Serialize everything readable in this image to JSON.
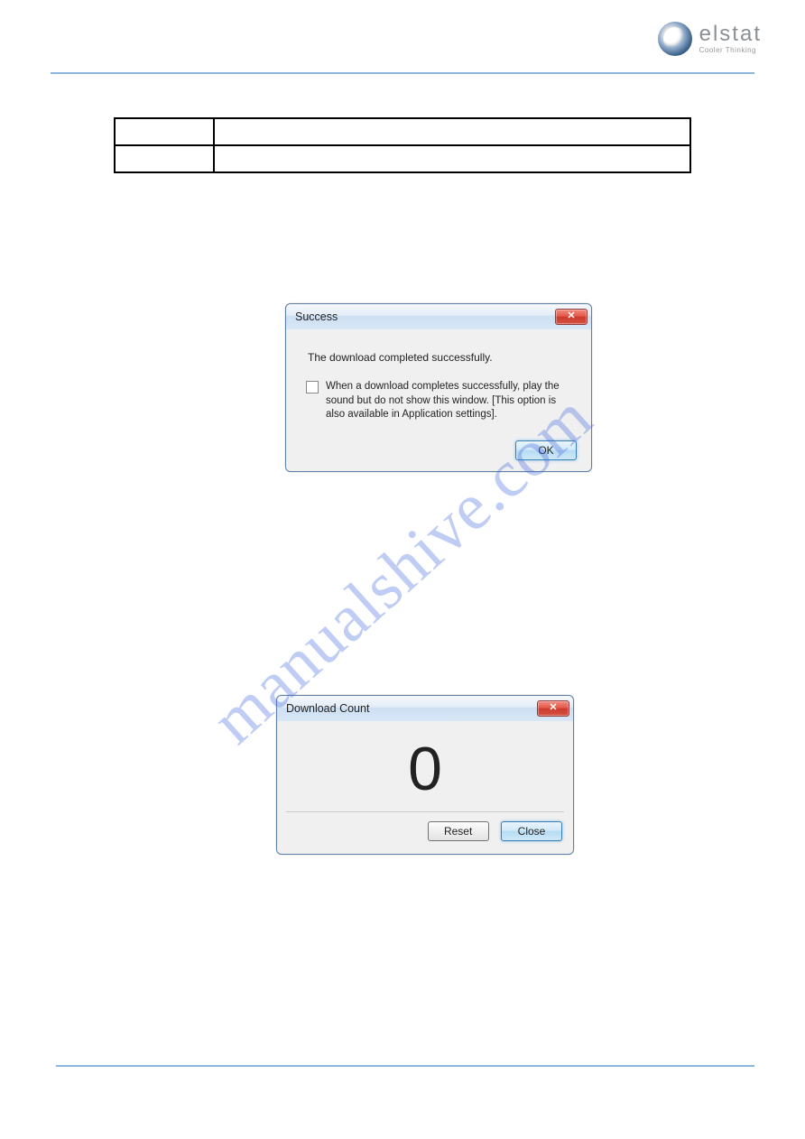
{
  "logo": {
    "name": "elstat",
    "tagline": "Cooler Thinking"
  },
  "table": {
    "rows": [
      {
        "c1": "",
        "c2": "",
        "fig": ""
      },
      {
        "c1": "",
        "c2": ""
      }
    ]
  },
  "dialog1": {
    "title": "Success",
    "message": "The download completed successfully.",
    "checkbox_text": "When a download completes successfully, play the sound but do not show this window. [This option is also available in Application settings].",
    "ok": "OK"
  },
  "dialog2": {
    "title": "Download Count",
    "count": "0",
    "reset": "Reset",
    "close": "Close"
  },
  "watermark": "manualshive.com",
  "close_glyph": "✕"
}
